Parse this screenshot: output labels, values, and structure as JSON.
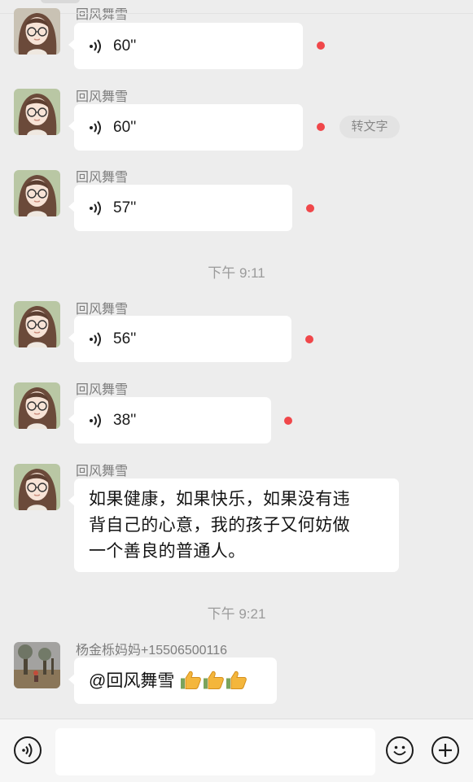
{
  "top_sender_partial": "回风舞雪",
  "messages": [
    {
      "sender": "回风舞雪",
      "duration": "60''"
    },
    {
      "sender": "回风舞雪",
      "duration": "60''",
      "action": "转文字"
    },
    {
      "sender": "回风舞雪",
      "duration": "57''"
    },
    {
      "timestamp": "下午 9:11"
    },
    {
      "sender": "回风舞雪",
      "duration": "56''"
    },
    {
      "sender": "回风舞雪",
      "duration": "38''"
    },
    {
      "sender": "回风舞雪",
      "text": "如果健康，如果快乐，如果没有违背自己的心意，我的孩子又何妨做一个善良的普通人。"
    },
    {
      "timestamp": "下午 9:21"
    },
    {
      "sender": "杨金栎妈妈+15506500116",
      "text": "@回风舞雪",
      "emoji": "thumbs-up-icon x3"
    }
  ],
  "text_line1": "如果健康，如果快乐，如果没有违",
  "text_line2": "背自己的心意，我的孩子又何妨做",
  "text_line3": "一个善良的普通人。",
  "colors": {
    "unread_dot": "#f0474a",
    "background": "#ededed",
    "bubble": "#ffffff"
  },
  "input_bar": {
    "left_icon": "voice-mode-icon",
    "right_icons": [
      "emoji-icon",
      "add-icon"
    ],
    "input_value": ""
  }
}
